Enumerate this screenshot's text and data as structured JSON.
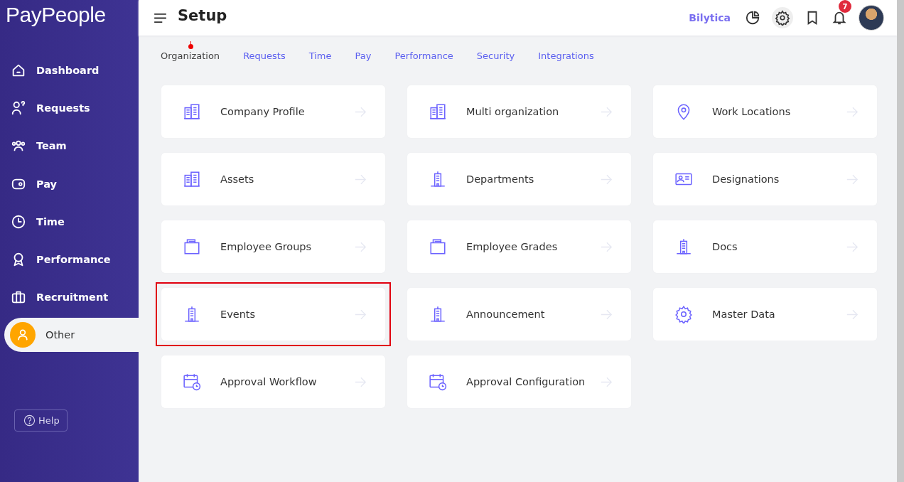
{
  "sidebar": {
    "logo": "PayPeople",
    "items": [
      {
        "label": "Dashboard",
        "kind": "home",
        "selected": false
      },
      {
        "label": "Requests",
        "kind": "requests",
        "selected": false
      },
      {
        "label": "Team",
        "kind": "team",
        "selected": false
      },
      {
        "label": "Pay",
        "kind": "pay",
        "selected": false
      },
      {
        "label": "Time",
        "kind": "time",
        "selected": false
      },
      {
        "label": "Performance",
        "kind": "performance",
        "selected": false
      },
      {
        "label": "Recruitment",
        "kind": "recruitment",
        "selected": false
      },
      {
        "label": "Other",
        "kind": "other",
        "selected": true
      }
    ],
    "help": "Help"
  },
  "header": {
    "title": "Setup",
    "company": "Bilytica",
    "notifications": "7"
  },
  "tabs": [
    {
      "label": "Organization",
      "selected": true
    },
    {
      "label": "Requests",
      "selected": false
    },
    {
      "label": "Time",
      "selected": false
    },
    {
      "label": "Pay",
      "selected": false
    },
    {
      "label": "Performance",
      "selected": false
    },
    {
      "label": "Security",
      "selected": false
    },
    {
      "label": "Integrations",
      "selected": false
    }
  ],
  "cards": [
    {
      "label": "Company Profile",
      "kind": "buildings",
      "highlighted": false
    },
    {
      "label": "Multi organization",
      "kind": "buildings",
      "highlighted": false
    },
    {
      "label": "Work Locations",
      "kind": "pin",
      "highlighted": false
    },
    {
      "label": "Assets",
      "kind": "buildings",
      "highlighted": false
    },
    {
      "label": "Departments",
      "kind": "tower",
      "highlighted": false
    },
    {
      "label": "Designations",
      "kind": "idcard",
      "highlighted": false
    },
    {
      "label": "Employee Groups",
      "kind": "folder",
      "highlighted": false
    },
    {
      "label": "Employee Grades",
      "kind": "folder",
      "highlighted": false
    },
    {
      "label": "Docs",
      "kind": "tower",
      "highlighted": false
    },
    {
      "label": "Events",
      "kind": "tower",
      "highlighted": true
    },
    {
      "label": "Announcement",
      "kind": "tower",
      "highlighted": false
    },
    {
      "label": "Master Data",
      "kind": "gear",
      "highlighted": false
    },
    {
      "label": "Approval Workflow",
      "kind": "calendar",
      "highlighted": false
    },
    {
      "label": "Approval Configuration",
      "kind": "calendar",
      "highlighted": false
    }
  ]
}
